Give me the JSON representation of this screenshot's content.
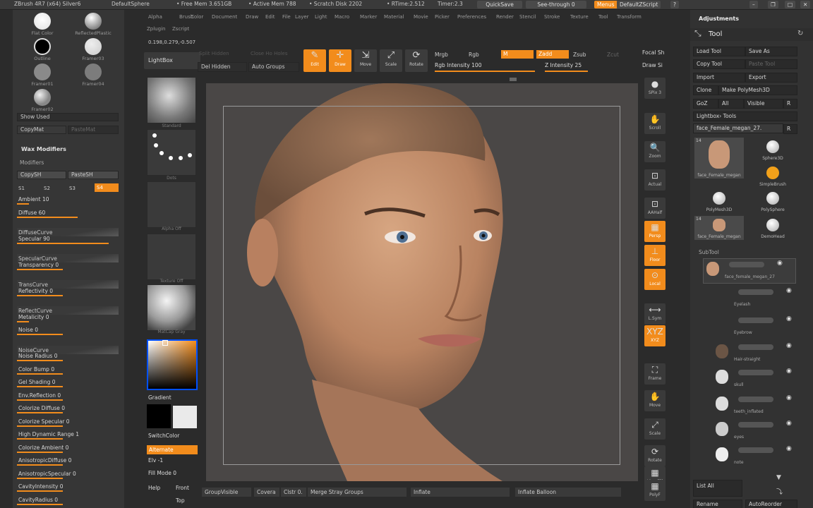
{
  "titlebar": {
    "app": "ZBrush 4R7 (x64) Silver6",
    "doc": "DefaultSphere",
    "free_mem": "• Free Mem 3.651GB",
    "active_mem": "• Active Mem 788",
    "scratch": "• Scratch Disk 2202",
    "rtime": "• RTime:2.512",
    "timer": "Timer:2.3",
    "quicksave": "QuickSave",
    "seethrough": "See-through  0",
    "menus": "Menus",
    "script": "DefaultZScript"
  },
  "menu": [
    "Alpha",
    "Brush",
    "Color",
    "Document",
    "Draw",
    "Edit",
    "File",
    "Layer",
    "Light",
    "Macro",
    "Marker",
    "Material",
    "Movie",
    "Picker",
    "Preferences",
    "Render",
    "Stencil",
    "Stroke",
    "Texture",
    "Tool",
    "Transform",
    "Zplugin",
    "Zscript"
  ],
  "coords": "0.198,0.279,-0.507",
  "materials": [
    {
      "label": "Flat Color"
    },
    {
      "label": "ReflectedPlastic"
    },
    {
      "label": "Outline"
    },
    {
      "label": "Framer03"
    },
    {
      "label": "Framer01"
    },
    {
      "label": "Framer04"
    },
    {
      "label": "Framer02"
    }
  ],
  "left": {
    "show_used": "Show Used",
    "copymat": "CopyMat",
    "pastemat": "PasteMat",
    "wax": "Wax Modifiers",
    "modifiers": "Modifiers",
    "copysh": "CopySH",
    "pastesh": "PasteSH",
    "s1": "S1",
    "s2": "S2",
    "s3": "S3",
    "s4": "S4"
  },
  "sliders": [
    {
      "label": "Ambient 10",
      "fill": 0.1,
      "curve": false
    },
    {
      "label": "Diffuse 60",
      "fill": 0.6,
      "curve": false
    },
    {
      "label": "DiffuseCurve",
      "curve": true
    },
    {
      "label": "Specular 90",
      "fill": 0.9,
      "curve": false
    },
    {
      "label": "SpecularCurve",
      "curve": true
    },
    {
      "label": "Transparency 0",
      "fill": 0.45,
      "curve": false
    },
    {
      "label": "TransCurve",
      "curve": true
    },
    {
      "label": "Reflectivity 0",
      "fill": 0.45,
      "curve": false
    },
    {
      "label": "ReflectCurve",
      "curve": true
    },
    {
      "label": "Metalicity 0",
      "fill": 0.0,
      "curve": false
    },
    {
      "label": "Noise 0",
      "fill": 0.45,
      "curve": false
    },
    {
      "label": "NoiseCurve",
      "curve": true
    },
    {
      "label": "Noise Radius 0",
      "fill": 0.45,
      "curve": false
    },
    {
      "label": "Color Bump 0",
      "fill": 0.45,
      "curve": false
    },
    {
      "label": "Gel Shading 0",
      "fill": 0.45,
      "curve": false
    },
    {
      "label": "Env.Reflection 0",
      "fill": 0.45,
      "curve": false
    },
    {
      "label": "Colorize Diffuse 0",
      "fill": 0.45,
      "curve": false
    },
    {
      "label": "Colorize Specular 0",
      "fill": 0.45,
      "curve": false
    },
    {
      "label": "High Dynamic Range 1",
      "fill": 0.45,
      "curve": false
    },
    {
      "label": "Colorize Ambient 0",
      "fill": 0.45,
      "curve": false
    },
    {
      "label": "AnisotropicDiffuse 0",
      "fill": 0.45,
      "curve": false
    },
    {
      "label": "AnisotropicSpecular 0",
      "fill": 0.45,
      "curve": false
    },
    {
      "label": "CavityIntensity 0",
      "fill": 0.45,
      "curve": false
    },
    {
      "label": "CavityRadius 0",
      "fill": 0.45,
      "curve": false
    }
  ],
  "top": {
    "lightbox": "LightBox",
    "split_hidden": "Split Hidden",
    "close_holes": "Close Ho Holes",
    "del_hidden": "Del Hidden",
    "auto_groups": "Auto Groups",
    "edit": "Edit",
    "draw": "Draw",
    "move": "Move",
    "scale": "Scale",
    "rotate": "Rotate",
    "mrgb": "Mrgb",
    "rgb": "Rgb",
    "m": "M",
    "zadd": "Zadd",
    "zsub": "Zsub",
    "zcut": "Zcut",
    "rgb_intensity": "Rgb Intensity 100",
    "z_intensity": "Z Intensity 25",
    "focal": "Focal Sh",
    "draw_size": "Draw Si"
  },
  "brushes": [
    "Standard",
    "Dots",
    "Alpha Off",
    "Texture Off",
    "MatCap Gray"
  ],
  "color": {
    "gradient": "Gradient",
    "switchcolor": "SwitchColor",
    "alternate": "Alternate",
    "elv": "Elv -1",
    "fillmode": "Fill Mode 0",
    "help": "Help",
    "front": "Front",
    "top": "Top"
  },
  "right_tools": [
    "SPix 3",
    "Scroll",
    "Zoom",
    "Actual",
    "AAHalf",
    "Persp",
    "Floor",
    "Local",
    "L.Sym",
    "XYZ",
    "Frame",
    "Move",
    "Scale",
    "Rotate",
    "Line Fill",
    "PolyF"
  ],
  "bottom": {
    "groupvisible": "GroupVisible",
    "coverage": "Covera",
    "clstr": "Clstr 0.",
    "merge": "Merge Stray Groups",
    "inflate": "Inflate",
    "inflate_balloon": "Inflate Balloon"
  },
  "rp": {
    "adjust": "Adjustments",
    "tool": "Tool",
    "load": "Load Tool",
    "saveas": "Save As",
    "copytool": "Copy Tool",
    "pastetool": "Paste Tool",
    "import": "Import",
    "export": "Export",
    "clone": "Clone",
    "make": "Make PolyMesh3D",
    "goz": "GoZ",
    "all": "All",
    "visible": "Visible",
    "r": "R",
    "lightboxtools": "Lightbox› Tools",
    "current": "face_Female_megan_27.",
    "subtool": "SubTool",
    "listall": "List All",
    "rename": "Rename",
    "autoreorder": "AutoReorder"
  },
  "toolthumbs": [
    {
      "label": "face_Female_megan",
      "num": "14"
    },
    {
      "label": "Sphere3D",
      "num": ""
    },
    {
      "label": "SimpleBrush",
      "num": ""
    },
    {
      "label": "PolyMesh3D",
      "num": ""
    },
    {
      "label": "PolySphere",
      "num": ""
    },
    {
      "label": "face_Female_megan",
      "num": "14"
    },
    {
      "label": "DemoHead",
      "num": ""
    }
  ],
  "subtools": [
    "face_female_megan_27",
    "Eyelash",
    "Eyebrow",
    "Hair-straight",
    "skull",
    "teeth_inflated",
    "eyes",
    "note"
  ]
}
